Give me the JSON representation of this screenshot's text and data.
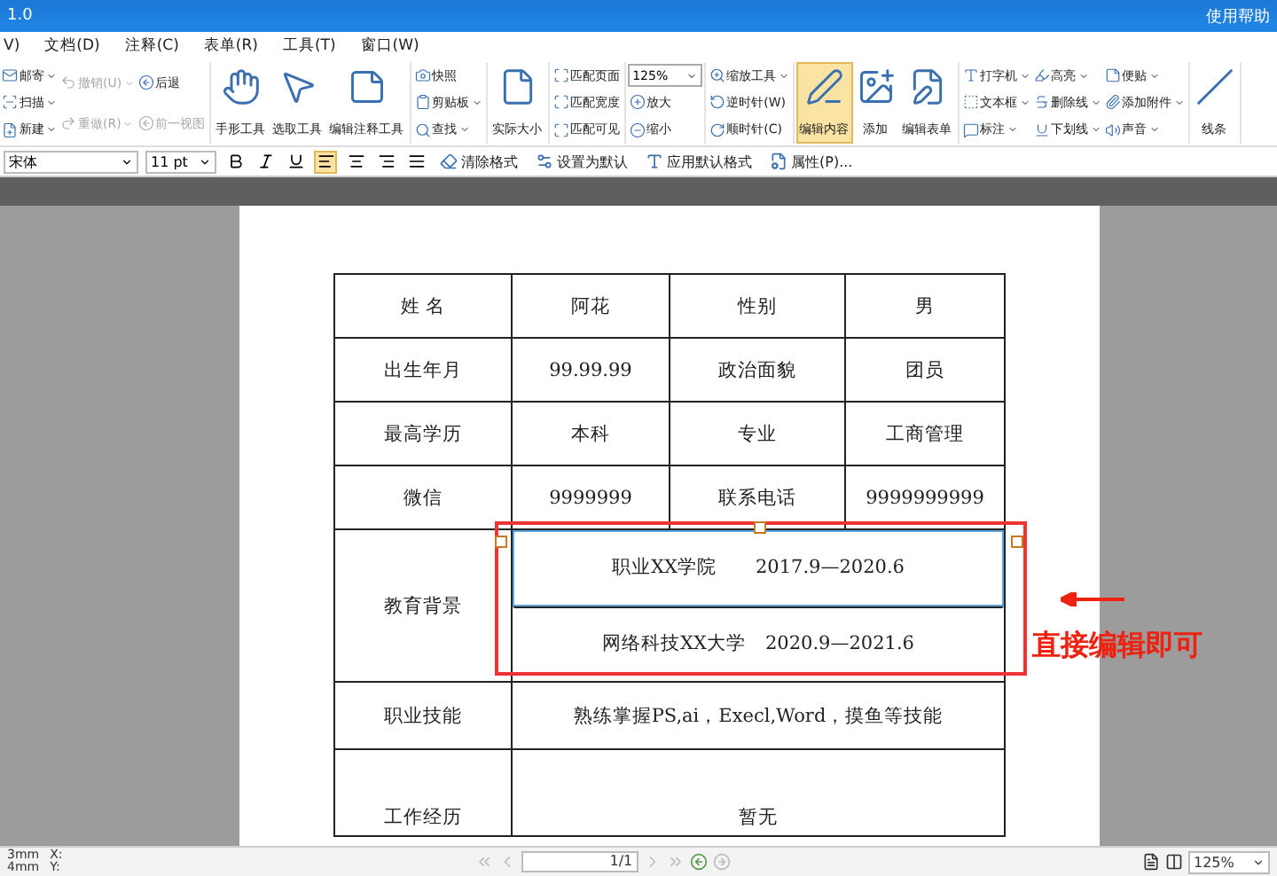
{
  "window": {
    "title": "1.0",
    "help": "使用帮助"
  },
  "menu": [
    {
      "label": "V)"
    },
    {
      "label": "文档(D)"
    },
    {
      "label": "注释(C)"
    },
    {
      "label": "表单(R)"
    },
    {
      "label": "工具(T)"
    },
    {
      "label": "窗口(W)"
    }
  ],
  "ribbon": {
    "groups": [
      {
        "kind": "small",
        "columns": [
          [
            {
              "label": "邮寄",
              "dropdown": true,
              "disabled": false
            },
            {
              "label": "扫描",
              "dropdown": true,
              "disabled": false
            },
            {
              "label": "新建",
              "dropdown": true,
              "disabled": false
            }
          ],
          [
            {
              "label": "撤销(U)",
              "dropdown": true,
              "disabled": true
            },
            {
              "label": "重做(R)",
              "dropdown": true,
              "disabled": true
            }
          ],
          [
            {
              "label": "后退",
              "dropdown": false,
              "disabled": false
            },
            {
              "label": "前一视图",
              "dropdown": false,
              "disabled": true
            }
          ]
        ]
      },
      {
        "kind": "large",
        "buttons": [
          {
            "label": "手形工具",
            "selected": false
          },
          {
            "label": "选取工具",
            "selected": false
          },
          {
            "label": "编辑注释工具",
            "selected": false
          }
        ]
      },
      {
        "kind": "small",
        "columns": [
          [
            {
              "label": "快照",
              "dropdown": false,
              "disabled": false
            },
            {
              "label": "剪贴板",
              "dropdown": true,
              "disabled": false
            },
            {
              "label": "查找",
              "dropdown": true,
              "disabled": false
            }
          ]
        ]
      },
      {
        "kind": "large",
        "buttons": [
          {
            "label": "实际大小",
            "selected": false
          }
        ]
      },
      {
        "kind": "small",
        "columns": [
          [
            {
              "label": "匹配页面",
              "dropdown": false,
              "disabled": false
            },
            {
              "label": "匹配宽度",
              "dropdown": false,
              "disabled": false
            },
            {
              "label": "匹配可见",
              "dropdown": false,
              "disabled": false
            }
          ]
        ]
      },
      {
        "kind": "zoom",
        "value": "125%",
        "items": [
          {
            "label": "放大",
            "dropdown": false,
            "disabled": false
          },
          {
            "label": "缩小",
            "dropdown": false,
            "disabled": false
          }
        ]
      },
      {
        "kind": "small",
        "columns": [
          [
            {
              "label": "缩放工具",
              "dropdown": true,
              "disabled": false
            },
            {
              "label": "逆时针(W)",
              "dropdown": false,
              "disabled": false
            },
            {
              "label": "顺时针(C)",
              "dropdown": false,
              "disabled": false
            }
          ]
        ]
      },
      {
        "kind": "large",
        "buttons": [
          {
            "label": "编辑内容",
            "selected": true
          },
          {
            "label": "添加",
            "selected": false
          },
          {
            "label": "编辑表单",
            "selected": false
          }
        ]
      },
      {
        "kind": "small",
        "columns": [
          [
            {
              "label": "打字机",
              "dropdown": true,
              "disabled": false
            },
            {
              "label": "文本框",
              "dropdown": true,
              "disabled": false
            },
            {
              "label": "标注",
              "dropdown": true,
              "disabled": false
            }
          ],
          [
            {
              "label": "高亮",
              "dropdown": true,
              "disabled": false
            },
            {
              "label": "删除线",
              "dropdown": true,
              "disabled": false
            },
            {
              "label": "下划线",
              "dropdown": true,
              "disabled": false
            }
          ],
          [
            {
              "label": "便贴",
              "dropdown": true,
              "disabled": false
            },
            {
              "label": "添加附件",
              "dropdown": true,
              "disabled": false
            },
            {
              "label": "声音",
              "dropdown": true,
              "disabled": false
            }
          ]
        ]
      },
      {
        "kind": "large",
        "buttons": [
          {
            "label": "线条",
            "selected": false
          }
        ]
      }
    ]
  },
  "format_bar": {
    "font": "宋体",
    "size": "11 pt",
    "align": [
      {
        "selected": true
      },
      {
        "selected": false
      },
      {
        "selected": false
      },
      {
        "selected": false
      }
    ],
    "actions": [
      {
        "label": "清除格式"
      },
      {
        "label": "设置为默认"
      },
      {
        "label": "应用默认格式"
      },
      {
        "label": "属性(P)..."
      }
    ]
  },
  "table": {
    "rows": [
      {
        "kind": "four",
        "cells": [
          "姓 名",
          "阿花",
          "性别",
          "男"
        ]
      },
      {
        "kind": "four",
        "cells": [
          "出生年月",
          "99.99.99",
          "政治面貌",
          "团员"
        ]
      },
      {
        "kind": "four",
        "cells": [
          "最高学历",
          "本科",
          "专业",
          "工商管理"
        ]
      },
      {
        "kind": "four",
        "cells": [
          "微信",
          "9999999",
          "联系电话",
          "9999999999"
        ]
      },
      {
        "kind": "list",
        "label": "教育背景",
        "lines": [
          {
            "text": "职业XX学院　　2017.9—2020.6",
            "selected": true
          },
          {
            "text": "网络科技XX大学　2020.9—2021.6",
            "selected": false
          }
        ]
      },
      {
        "kind": "wide",
        "label": "职业技能",
        "text": "熟练掌握PS,ai，Execl,Word，摸鱼等技能"
      },
      {
        "kind": "tall",
        "label": "工作经历",
        "text": "暂无"
      }
    ]
  },
  "annotation": {
    "text": "直接编辑即可"
  },
  "status_bar": {
    "units": [
      "3mm",
      "4mm"
    ],
    "coords": [
      "X:",
      "Y:"
    ],
    "page": "1/1",
    "zoom": "125%"
  }
}
